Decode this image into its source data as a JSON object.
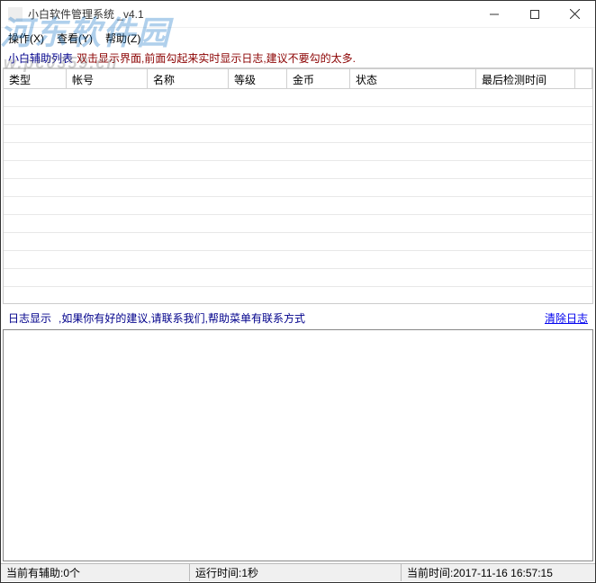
{
  "window": {
    "title": "小白软件管理系统 _v4.1"
  },
  "menu": {
    "operate": "操作(X)",
    "view": "查看(Y)",
    "help": "帮助(Z)"
  },
  "info": {
    "label": "小白辅助列表",
    "hint": "双击显示界面,前面勾起来实时显示日志,建议不要勾的太多."
  },
  "columns": [
    "类型",
    "帐号",
    "名称",
    "等级",
    "金币",
    "状态",
    "最后检测时间",
    ""
  ],
  "log": {
    "title": "日志显示",
    "hint": ",如果你有好的建议,请联系我们,帮助菜单有联系方式",
    "clear": "清除日志"
  },
  "status": {
    "helper_count_label": "当前有辅助:",
    "helper_count_value": "0个",
    "runtime_label": "运行时间:",
    "runtime_value": "1秒",
    "now_label": "当前时间:",
    "now_value": "2017-11-16 16:57:15"
  },
  "watermark": {
    "main": "河东软件园",
    "sub": "w.pc0359.cn"
  }
}
